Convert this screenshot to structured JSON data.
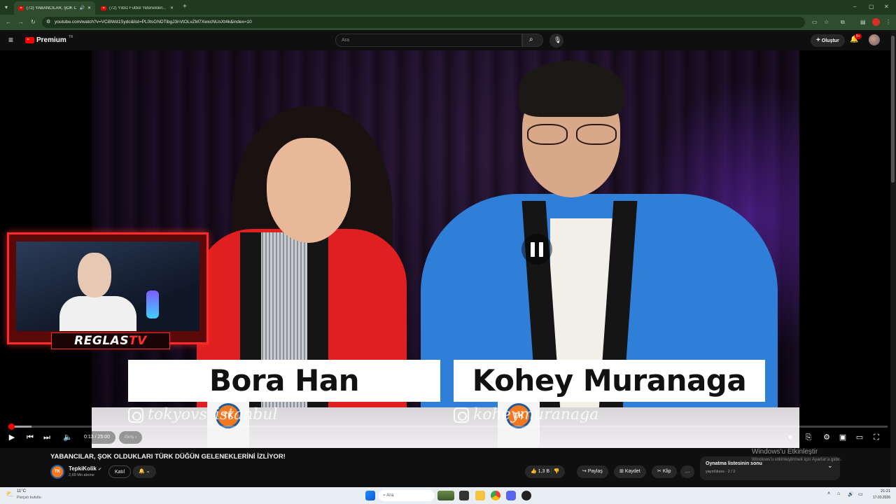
{
  "browser": {
    "tabs": [
      {
        "title": "(72) YABANCILAR, ŞOK OL...",
        "active": true
      },
      {
        "title": "(72) Yıldız Futbol Yetenekleri...",
        "active": false
      }
    ],
    "url": "youtube.com/watch?v=VCi8Wd1Sydc&list=PL0tsGNDTibgJ3nVtOLvZM7XwxcNUsXt4k&index=10",
    "window_controls": {
      "minimize": "–",
      "restore": "▢",
      "close": "✕"
    }
  },
  "youtube": {
    "logo_text": "Premium",
    "logo_badge": "TR",
    "search_placeholder": "Ara",
    "create_label": "Oluştur",
    "notifications_badge": "9+"
  },
  "video": {
    "name_left": "Bora Han",
    "name_right": "Kohey Muranaga",
    "handle_left": "tokyovs_istanbul",
    "handle_right": "koheymuranaga",
    "mug_logo": "TK",
    "webcam_logo_prefix": "REGLAS",
    "webcam_logo_suffix": "TV",
    "state": "paused"
  },
  "player_controls": {
    "time": "0:13 / 25:00",
    "chapter": "Giriş ›",
    "progress_played_fraction": 0.0007,
    "progress_loaded_fraction": 0.026
  },
  "below_video": {
    "title": "YABANCILAR, ŞOK OLDUKLARI TÜRK DÜĞÜN GELENEKLERİNİ İZLİYOR!",
    "channel_name": "TepkiKolik",
    "channel_avatar": "TK",
    "subscribers": "2,69 Mn abone",
    "join_label": "Katıl",
    "likes": "1,3 B",
    "share_label": "Paylaş",
    "save_label": "Kaydet",
    "clip_label": "Klip",
    "more_label": "…"
  },
  "playlist": {
    "title": "Oynatma listesinin sonu",
    "subtitle": "yayınlıksss - 2 / 2"
  },
  "windows_activation": {
    "title": "Windows'u Etkinleştir",
    "subtitle": "Windows'u etkinleştirmek için Ayarlar'a gidin."
  },
  "taskbar": {
    "weather_temp": "11°C",
    "weather_desc": "Parçalı bulutlu",
    "search_placeholder": "Ara",
    "time": "21:21",
    "date": "17.03.2026"
  },
  "colors": {
    "youtube_red": "#ff0000",
    "browser_frame": "#1f3a1f",
    "page_bg": "#0f0f0f",
    "webcam_red": "#ff2a2a",
    "shirt_red": "#e02020",
    "shirt_blue": "#2f7fd8"
  }
}
